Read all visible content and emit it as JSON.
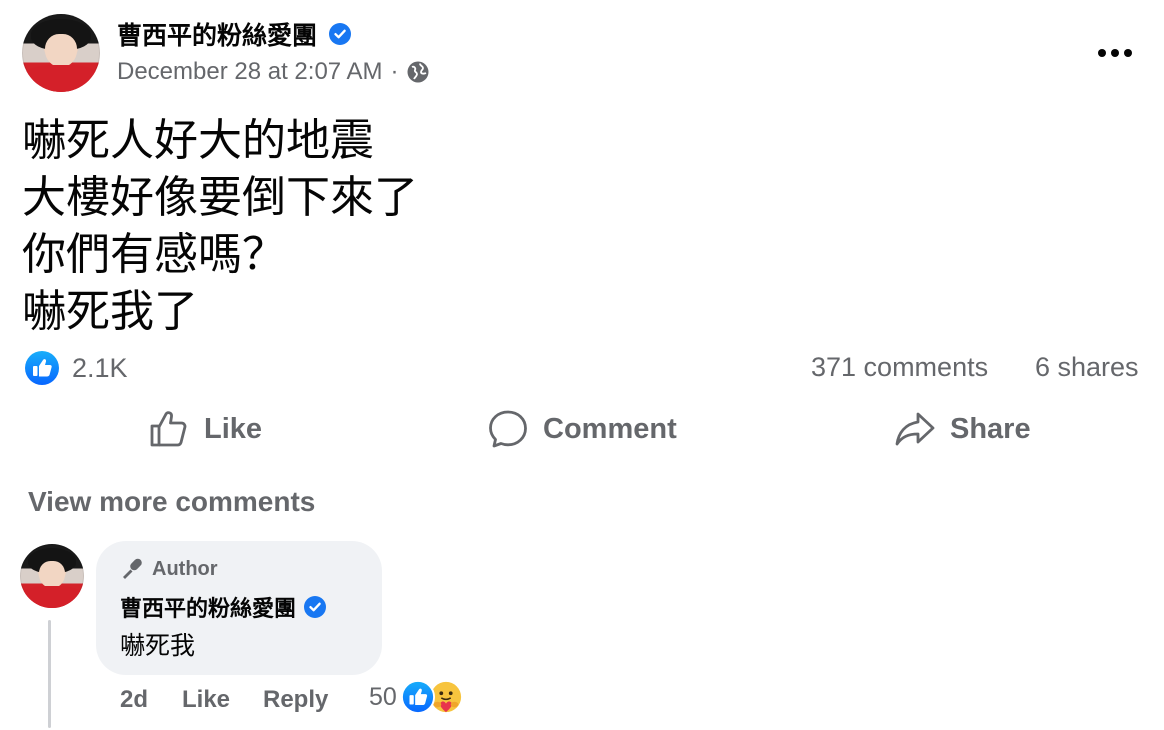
{
  "post": {
    "author": "曹西平的粉絲愛團",
    "timestamp": "December 28 at 2:07 AM",
    "separator": "·",
    "privacy_icon": "globe-icon",
    "lines": [
      "嚇死人好大的地震",
      "大樓好像要倒下來了",
      "你們有感嗎？",
      "嚇死我了"
    ]
  },
  "stats": {
    "reactions": "2.1K",
    "comments": "371 comments",
    "shares": "6 shares"
  },
  "actions": {
    "like": "Like",
    "comment": "Comment",
    "share": "Share"
  },
  "comments_section": {
    "view_more": "View more comments",
    "comment": {
      "badge": "Author",
      "author": "曹西平的粉絲愛團",
      "text": "嚇死我",
      "age": "2d",
      "like": "Like",
      "reply": "Reply",
      "reaction_count": "50"
    }
  },
  "colors": {
    "accent": "#1877f2",
    "secondary_text": "#65676b",
    "bubble": "#f0f2f5"
  }
}
